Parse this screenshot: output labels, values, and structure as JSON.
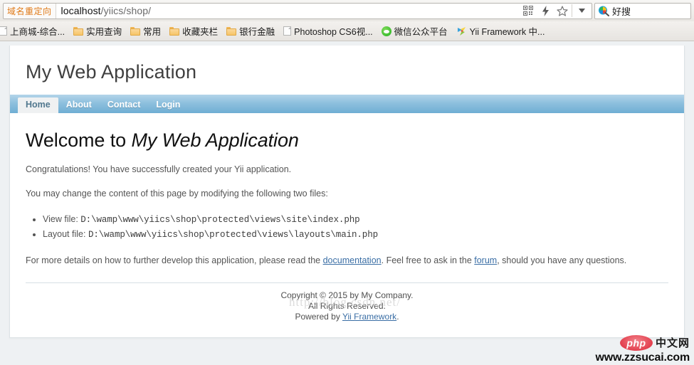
{
  "browser": {
    "omnibox": {
      "redirect_badge": "域名重定向",
      "url_host": "localhost",
      "url_path": "/yiics/shop/",
      "url_full": "localhost/yiics/shop/",
      "icons": [
        {
          "name": "qr-code-icon"
        },
        {
          "name": "lightning-icon"
        },
        {
          "name": "bookmark-star-icon"
        },
        {
          "name": "dropdown-arrow-icon"
        }
      ]
    },
    "search": {
      "engine_icon": "search-icon",
      "engine_label": "好搜",
      "placeholder": "好搜"
    },
    "bookmarks": [
      {
        "label": "上商城-综合...",
        "icon": "page-icon"
      },
      {
        "label": "实用查询",
        "icon": "folder-icon"
      },
      {
        "label": "常用",
        "icon": "folder-icon"
      },
      {
        "label": "收藏夹栏",
        "icon": "folder-icon"
      },
      {
        "label": "银行金融",
        "icon": "folder-icon"
      },
      {
        "label": "Photoshop CS6视...",
        "icon": "page-icon"
      },
      {
        "label": "微信公众平台",
        "icon": "wechat-icon"
      },
      {
        "label": "Yii Framework 中...",
        "icon": "yii-icon"
      }
    ]
  },
  "page": {
    "site_title": "My Web Application",
    "menu": [
      {
        "label": "Home",
        "active": true
      },
      {
        "label": "About",
        "active": false
      },
      {
        "label": "Contact",
        "active": false
      },
      {
        "label": "Login",
        "active": false
      }
    ],
    "heading_prefix": "Welcome to ",
    "heading_emphasis": "My Web Application",
    "paragraph_congrats": "Congratulations! You have successfully created your Yii application.",
    "paragraph_change": "You may change the content of this page by modifying the following two files:",
    "files": [
      {
        "label": "View file: ",
        "path": "D:\\wamp\\www\\yiics\\shop\\protected\\views\\site\\index.php"
      },
      {
        "label": "Layout file: ",
        "path": "D:\\wamp\\www\\yiics\\shop\\protected\\views\\layouts\\main.php"
      }
    ],
    "details_prefix": "For more details on how to further develop this application, please read the ",
    "link_documentation": "documentation",
    "details_middle": ". Feel free to ask in the ",
    "link_forum": "forum",
    "details_suffix": ", should you have any questions.",
    "footer": {
      "copyright": "Copyright © 2015 by My Company.",
      "rights": "All Rights Reserved.",
      "powered_prefix": "Powered by ",
      "powered_link": "Yii Framework",
      "powered_suffix": "."
    }
  },
  "watermarks": {
    "csdn": "http://blog.csdn.net/",
    "php_logo": "php",
    "php_cn": "中文网",
    "site_url": "www.zzsucai.com"
  },
  "colors": {
    "menu_blue": "#8ec0de",
    "active_tab_text": "#51788f",
    "link_blue": "#3a6ea5",
    "badge_orange": "#e07b19",
    "php_red": "#e23b4a"
  }
}
